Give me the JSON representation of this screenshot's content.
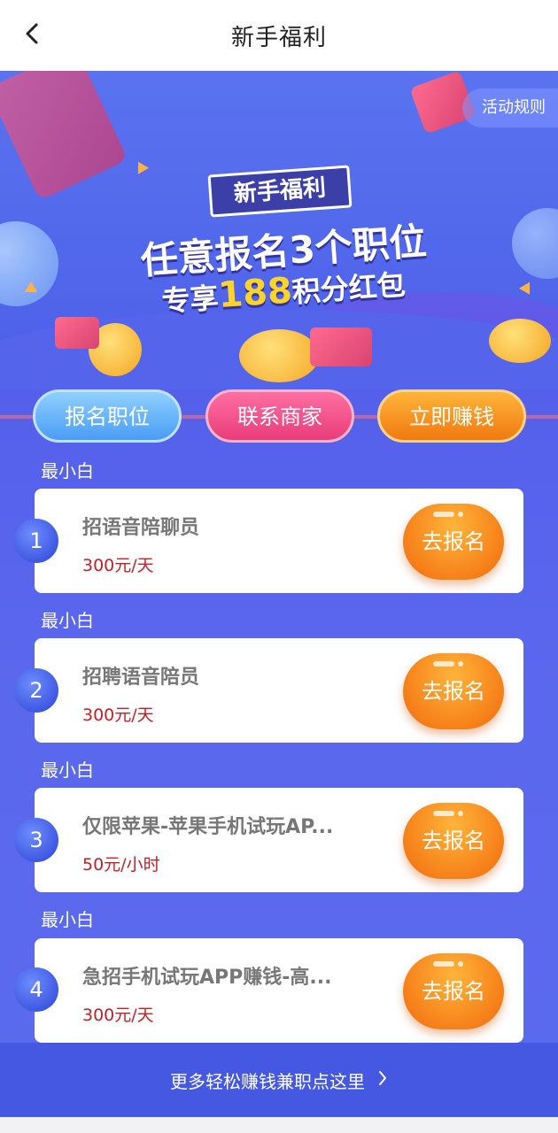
{
  "header": {
    "title": "新手福利",
    "back_icon": "chevron-left-icon"
  },
  "banner": {
    "rules_label": "活动规则",
    "badge": "新手福利",
    "headline_line1": "任意报名3个职位",
    "headline_line2_prefix": "专享",
    "headline_line2_number": "188",
    "headline_line2_suffix": "积分红包"
  },
  "steps": [
    {
      "label": "报名职位",
      "color": "#4a9cf5"
    },
    {
      "label": "联系商家",
      "color": "#e93c7a"
    },
    {
      "label": "立即赚钱",
      "color": "#f07a10"
    }
  ],
  "jobs": [
    {
      "number": "1",
      "category": "最小白",
      "title": "招语音陪聊员",
      "pay": "300元/天",
      "button": "去报名"
    },
    {
      "number": "2",
      "category": "最小白",
      "title": "招聘语音陪员",
      "pay": "300元/天",
      "button": "去报名"
    },
    {
      "number": "3",
      "category": "最小白",
      "title": "仅限苹果-苹果手机试玩AP...",
      "pay": "50元/小时",
      "button": "去报名"
    },
    {
      "number": "4",
      "category": "最小白",
      "title": "急招手机试玩APP赚钱-高...",
      "pay": "300元/天",
      "button": "去报名"
    }
  ],
  "footer": {
    "label": "更多轻松赚钱兼职点这里",
    "icon": "chevron-right-icon"
  },
  "colors": {
    "primary": "#5560ea",
    "accent_orange": "#f26a0c",
    "price_red": "#c0202a"
  }
}
